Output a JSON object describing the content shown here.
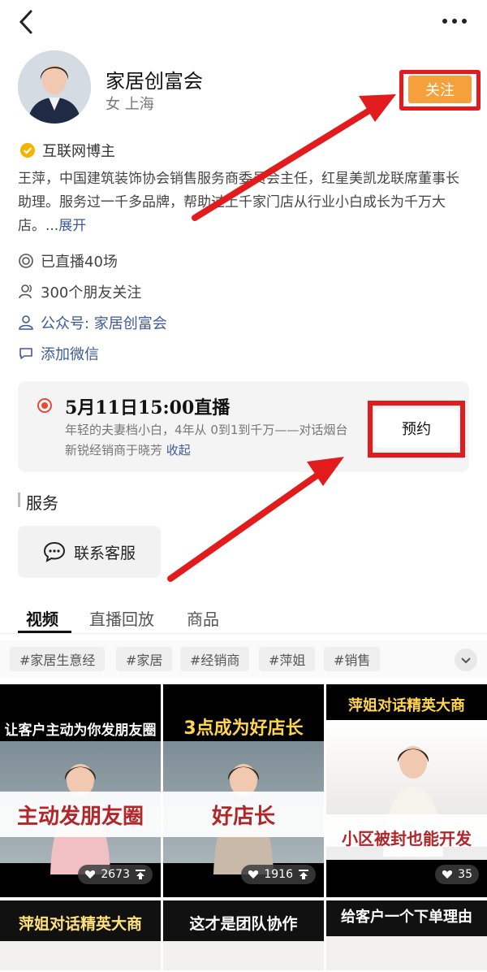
{
  "header": {
    "back_icon": "chevron-left-icon",
    "more_icon": "more-horizontal-icon"
  },
  "profile": {
    "name": "家居创富会",
    "gender_location": "女  上海",
    "follow_label": "关注",
    "verified_label": "互联网博主",
    "bio": "王萍，中国建筑装饰协会销售服务商委员会主任，红星美凯龙联席董事长助理。服务过一千多品牌，帮助过上千家门店从行业小白成长为千万大店。...",
    "expand_label": "展开",
    "live_count": "已直播40场",
    "friends_follow": "300个朋友关注",
    "official_account": "公众号: 家居创富会",
    "add_wechat": "添加微信"
  },
  "live": {
    "title": "5月11日15:00直播",
    "desc": "年轻的夫妻档小白，4年从 0到1到千万——对话烟台新锐经销商于晓芳 ",
    "collapse_label": "收起",
    "book_label": "预约"
  },
  "services": {
    "title": "服务",
    "contact_label": "联系客服"
  },
  "tabs": [
    {
      "label": "视频"
    },
    {
      "label": "直播回放"
    },
    {
      "label": "商品"
    }
  ],
  "tags": [
    "#家居生意经",
    "#家居",
    "#经销商",
    "#萍姐",
    "#销售"
  ],
  "videos": [
    {
      "top": "让客户主动为你发朋友圈",
      "band": "主动发朋友圈",
      "count": "2673"
    },
    {
      "top": "3点成为好店长",
      "band": "好店长",
      "count": "1916"
    },
    {
      "top": "萍姐对话精英大商",
      "band": "小区被封也能开发",
      "count": "35"
    },
    {
      "top": "萍姐对话精英大商"
    },
    {
      "top": "这才是团队协作"
    },
    {
      "top": "给客户一个下单理由"
    }
  ],
  "colors": {
    "accent_orange": "#f5a03a",
    "annotation_red": "#e21c1c",
    "link_blue": "#3d5a9b"
  }
}
